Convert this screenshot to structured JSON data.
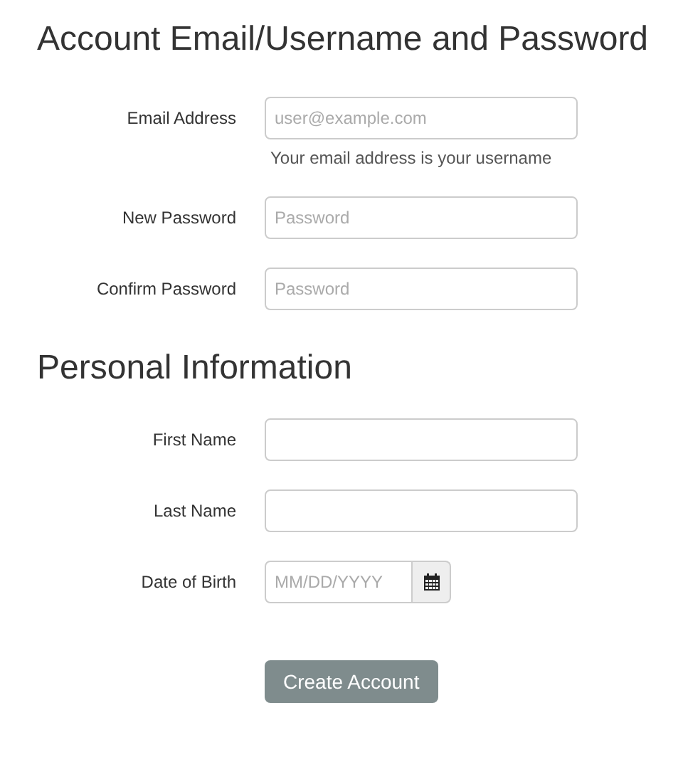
{
  "sections": [
    {
      "title": "Account Email/Username and Password",
      "fields": [
        {
          "kind": "text",
          "label": "Email Address",
          "placeholder": "user@example.com",
          "help": "Your email address is your username"
        },
        {
          "kind": "text",
          "label": "New Password",
          "placeholder": "Password"
        },
        {
          "kind": "text",
          "label": "Confirm Password",
          "placeholder": "Password"
        }
      ]
    },
    {
      "title": "Personal Information",
      "fields": [
        {
          "kind": "text",
          "label": "First Name"
        },
        {
          "kind": "text",
          "label": "Last Name"
        },
        {
          "kind": "date",
          "label": "Date of Birth",
          "placeholder": "MM/DD/YYYY"
        }
      ]
    }
  ],
  "submit": "Create Account"
}
